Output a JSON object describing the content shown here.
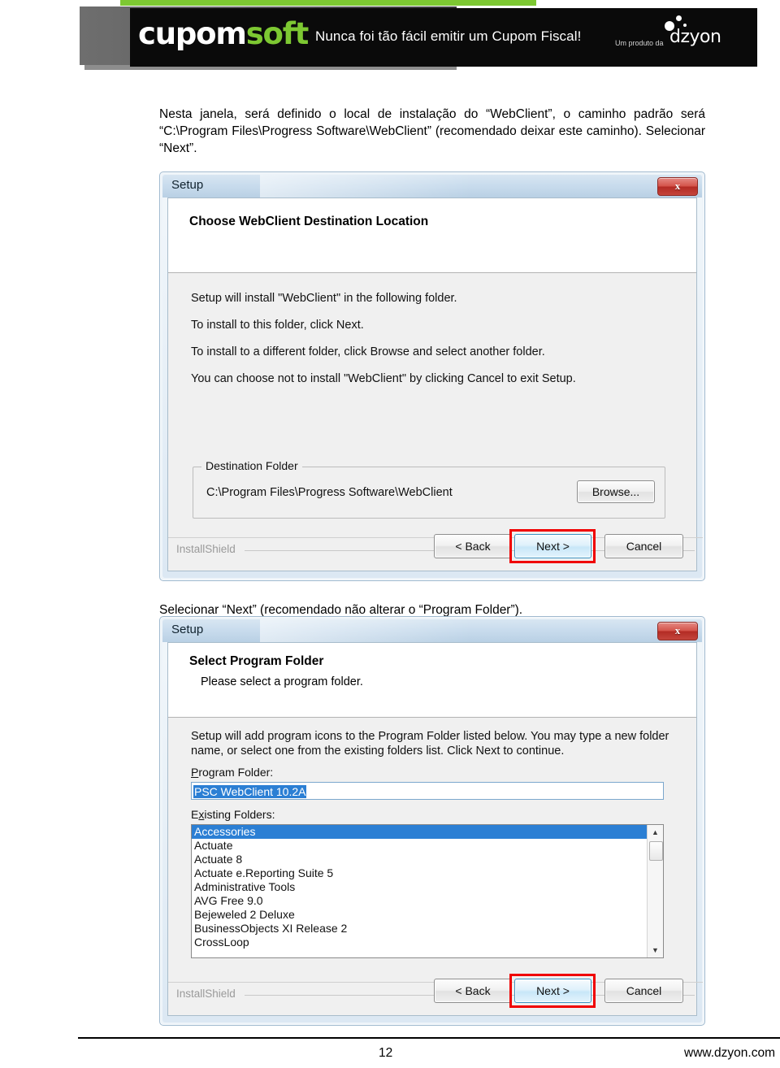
{
  "banner": {
    "logo_white": "cupom",
    "logo_green": "soft",
    "tagline": "Nunca foi tão fácil emitir um Cupom Fiscal!",
    "produced_by": "Um produto da",
    "company": "dzyon",
    "green_accent": "#7dc832"
  },
  "document": {
    "intro_paragraph": "Nesta janela, será definido o local de instalação do “WebClient”, o caminho padrão será “C:\\Program Files\\Progress Software\\WebClient” (recomendado deixar este caminho). Selecionar “Next”.",
    "mid_paragraph": "Selecionar “Next” (recomendado não alterar o “Program Folder”)."
  },
  "dialog1": {
    "title": "Setup",
    "close_label": "x",
    "heading": "Choose WebClient Destination Location",
    "lines": [
      "Setup will install \"WebClient\" in the following folder.",
      "To install to this folder, click Next.",
      "To install to a different folder, click Browse and select another folder.",
      "You can choose not to install \"WebClient\" by clicking Cancel to exit Setup."
    ],
    "group_legend": "Destination Folder",
    "group_value": "C:\\Program Files\\Progress Software\\WebClient",
    "browse_label": "Browse...",
    "installshield": "InstallShield",
    "back_label": "< Back",
    "next_label": "Next >",
    "cancel_label": "Cancel"
  },
  "dialog2": {
    "title": "Setup",
    "close_label": "x",
    "heading": "Select Program Folder",
    "subheading": "Please select a program folder.",
    "lines": [
      "Setup will add program icons to the Program Folder listed below.  You may type a new folder",
      "name, or select one from the existing folders list.  Click Next to continue."
    ],
    "program_folder_label": "Program Folder:",
    "program_folder_value": "PSC WebClient 10.2A",
    "existing_folders_label": "Existing Folders:",
    "existing_folders": [
      "Accessories",
      "Actuate",
      "Actuate 8",
      "Actuate e.Reporting Suite 5",
      "Administrative Tools",
      "AVG Free 9.0",
      "Bejeweled 2 Deluxe",
      "BusinessObjects XI Release 2",
      "CrossLoop"
    ],
    "selected_folder_index": 0,
    "scroll_up_icon": "▲",
    "scroll_down_icon": "▼",
    "installshield": "InstallShield",
    "back_label": "< Back",
    "next_label": "Next >",
    "cancel_label": "Cancel"
  },
  "footer": {
    "page_number": "12",
    "website": "www.dzyon.com"
  }
}
